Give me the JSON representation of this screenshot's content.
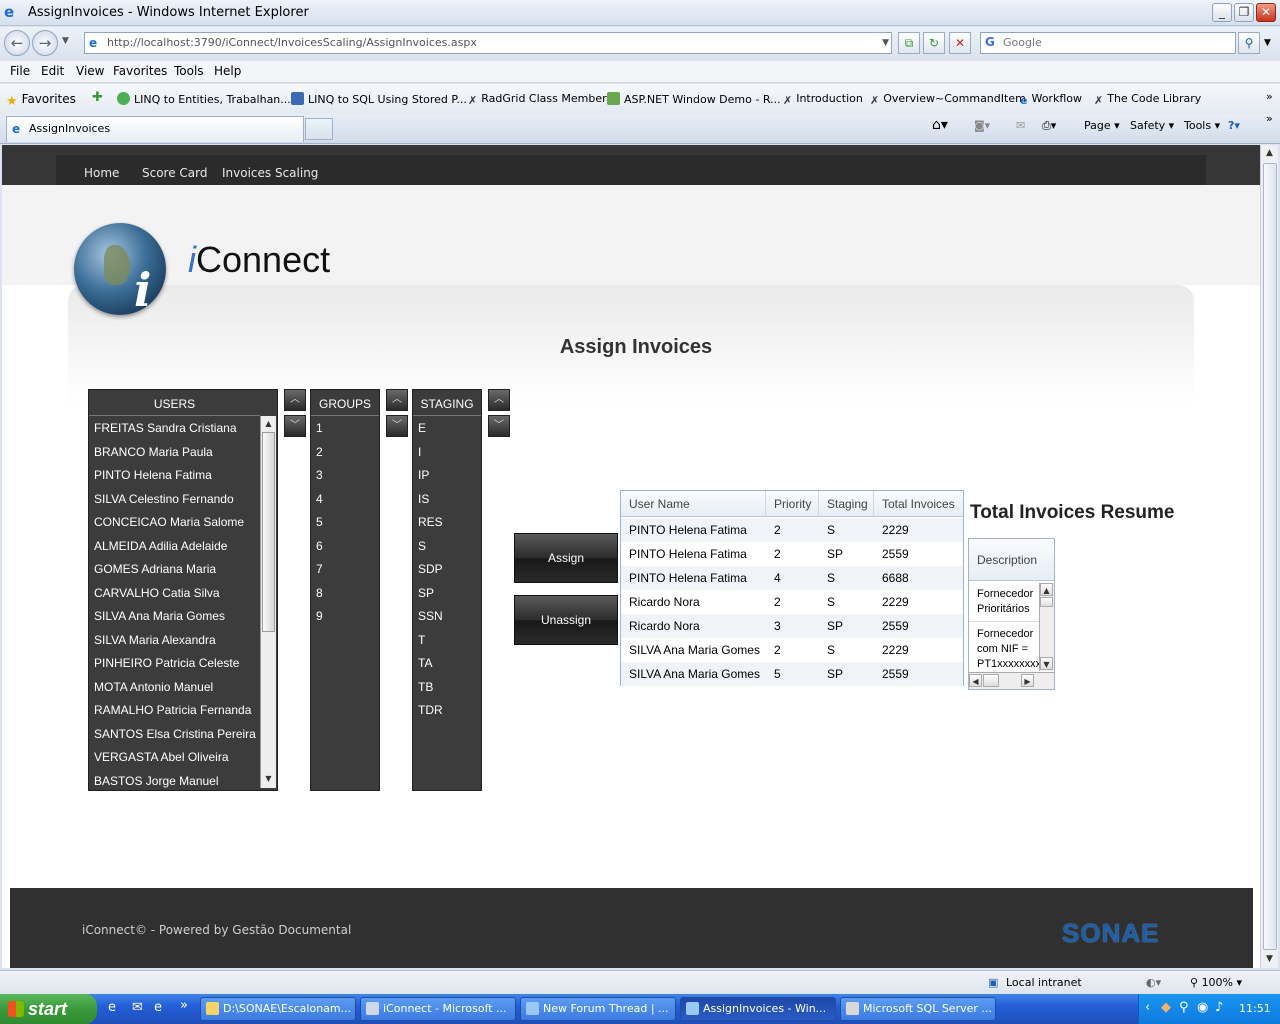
{
  "window": {
    "title": "AssignInvoices - Windows Internet Explorer",
    "address": "http://localhost:3790/iConnect/InvoicesScaling/AssignInvoices.aspx",
    "search_placeholder": "Google",
    "tab_title": "AssignInvoices"
  },
  "menu": [
    "File",
    "Edit",
    "View",
    "Favorites",
    "Tools",
    "Help"
  ],
  "favorites": {
    "label": "Favorites",
    "items": [
      "LINQ to Entities, Trabalhan...",
      "LINQ to SQL Using Stored P...",
      "RadGrid Class Members",
      "ASP.NET Window Demo - R...",
      "Introduction",
      "Overview~CommandItem",
      "Workflow",
      "The Code Library"
    ]
  },
  "commandbar": {
    "page": "Page",
    "safety": "Safety",
    "tools": "Tools"
  },
  "site": {
    "nav": [
      "Home",
      "Score Card",
      "Invoices Scaling"
    ],
    "logo_i": "i",
    "logo_rest": "Connect",
    "page_title": "Assign Invoices",
    "footer": "iConnect© - Powered by Gestão Documental",
    "sonae": "SONAE"
  },
  "users": {
    "header": "USERS",
    "items": [
      "FREITAS Sandra Cristiana",
      "BRANCO Maria Paula",
      "PINTO Helena Fatima",
      "SILVA Celestino Fernando",
      "CONCEICAO Maria Salome",
      "ALMEIDA Adilia Adelaide",
      "GOMES Adriana Maria",
      "CARVALHO Catia Silva",
      "SILVA Ana Maria Gomes",
      "SILVA Maria Alexandra",
      "PINHEIRO Patricia Celeste",
      "MOTA Antonio Manuel",
      "RAMALHO Patricia Fernanda",
      "SANTOS Elsa Cristina Pereira",
      "VERGASTA Abel Oliveira",
      "BASTOS Jorge Manuel"
    ]
  },
  "groups": {
    "header": "GROUPS",
    "items": [
      "1",
      "2",
      "3",
      "4",
      "5",
      "6",
      "7",
      "8",
      "9"
    ]
  },
  "staging": {
    "header": "STAGING",
    "items": [
      "E",
      "I",
      "IP",
      "IS",
      "RES",
      "S",
      "SDP",
      "SP",
      "SSN",
      "T",
      "TA",
      "TB",
      "TDR"
    ]
  },
  "buttons": {
    "assign": "Assign",
    "unassign": "Unassign"
  },
  "grid": {
    "columns": [
      "User Name",
      "Priority",
      "Staging",
      "Total Invoices"
    ],
    "rows": [
      [
        "PINTO Helena Fatima",
        "2",
        "S",
        "2229"
      ],
      [
        "PINTO Helena Fatima",
        "2",
        "SP",
        "2559"
      ],
      [
        "PINTO Helena Fatima",
        "4",
        "S",
        "6688"
      ],
      [
        "Ricardo Nora",
        "2",
        "S",
        "2229"
      ],
      [
        "Ricardo Nora",
        "3",
        "SP",
        "2559"
      ],
      [
        "SILVA Ana Maria Gomes",
        "2",
        "S",
        "2229"
      ],
      [
        "SILVA Ana Maria Gomes",
        "5",
        "SP",
        "2559"
      ]
    ]
  },
  "resume": {
    "title": "Total Invoices Resume",
    "header": "Description",
    "lines": [
      "Fornecedor",
      "Prioritários",
      "Fornecedor",
      "com NIF =",
      "PT1xxxxxxxx"
    ]
  },
  "status": {
    "zone": "Local intranet",
    "zoom": "100%"
  },
  "taskbar": {
    "start": "start",
    "tasks": [
      "D:\\SONAE\\Escalonam...",
      "iConnect - Microsoft ...",
      "New Forum Thread | ...",
      "AssignInvoices - Win...",
      "Microsoft SQL Server ..."
    ],
    "clock": "11:51"
  }
}
